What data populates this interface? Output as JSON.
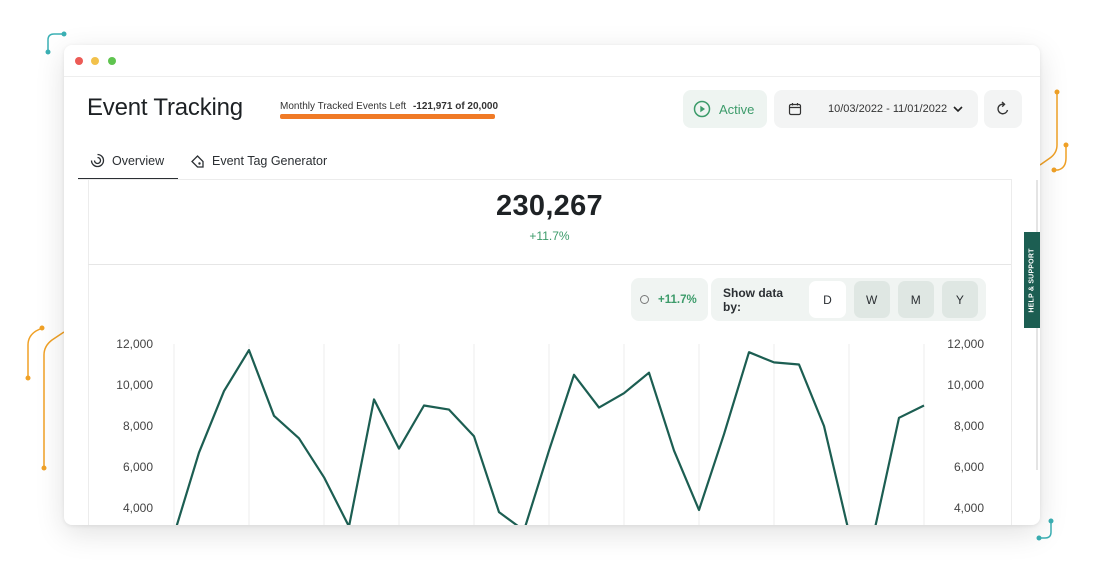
{
  "app": {
    "title": "Event Tracking",
    "events_left_label": "Monthly Tracked Events Left",
    "events_left_value": "-121,971 of 20,000",
    "events_used_fraction": 1.0
  },
  "header": {
    "status_label": "Active",
    "date_range": "10/03/2022 - 11/01/2022",
    "accent_color": "#3c9b6a",
    "usage_bar_color": "#f07a26"
  },
  "tabs": [
    {
      "label": "Overview",
      "icon": "overview-icon",
      "active": true
    },
    {
      "label": "Event Tag Generator",
      "icon": "tag-icon",
      "active": false
    }
  ],
  "summary": {
    "total": "230,267",
    "delta": "+11.7%"
  },
  "controls": {
    "compare_delta": "+11.7%",
    "show_by_label": "Show data by:",
    "periods": [
      "D",
      "W",
      "M",
      "Y"
    ],
    "selected_period": "D"
  },
  "help": {
    "label": "HELP & SUPPORT",
    "color": "#1c5e52"
  },
  "chart_data": {
    "type": "line",
    "yticks_left": [
      "12,000",
      "10,000",
      "8,000",
      "6,000",
      "4,000"
    ],
    "yticks_right": [
      "12,000",
      "10,000",
      "8,000",
      "6,000",
      "4,000"
    ],
    "ylim": [
      4000,
      12000
    ],
    "grid": "vertical",
    "line_color": "#1c5e52",
    "series": [
      {
        "values": [
          2700,
          6700,
          9700,
          11700,
          8500,
          7400,
          5500,
          3100,
          9300,
          6900,
          9000,
          8800,
          7500,
          3800,
          2900,
          6800,
          10500,
          8900,
          9600,
          10600,
          6800,
          3900,
          7600,
          11600,
          11100,
          11000,
          8000,
          2800,
          2800,
          8400,
          9000
        ]
      }
    ]
  }
}
